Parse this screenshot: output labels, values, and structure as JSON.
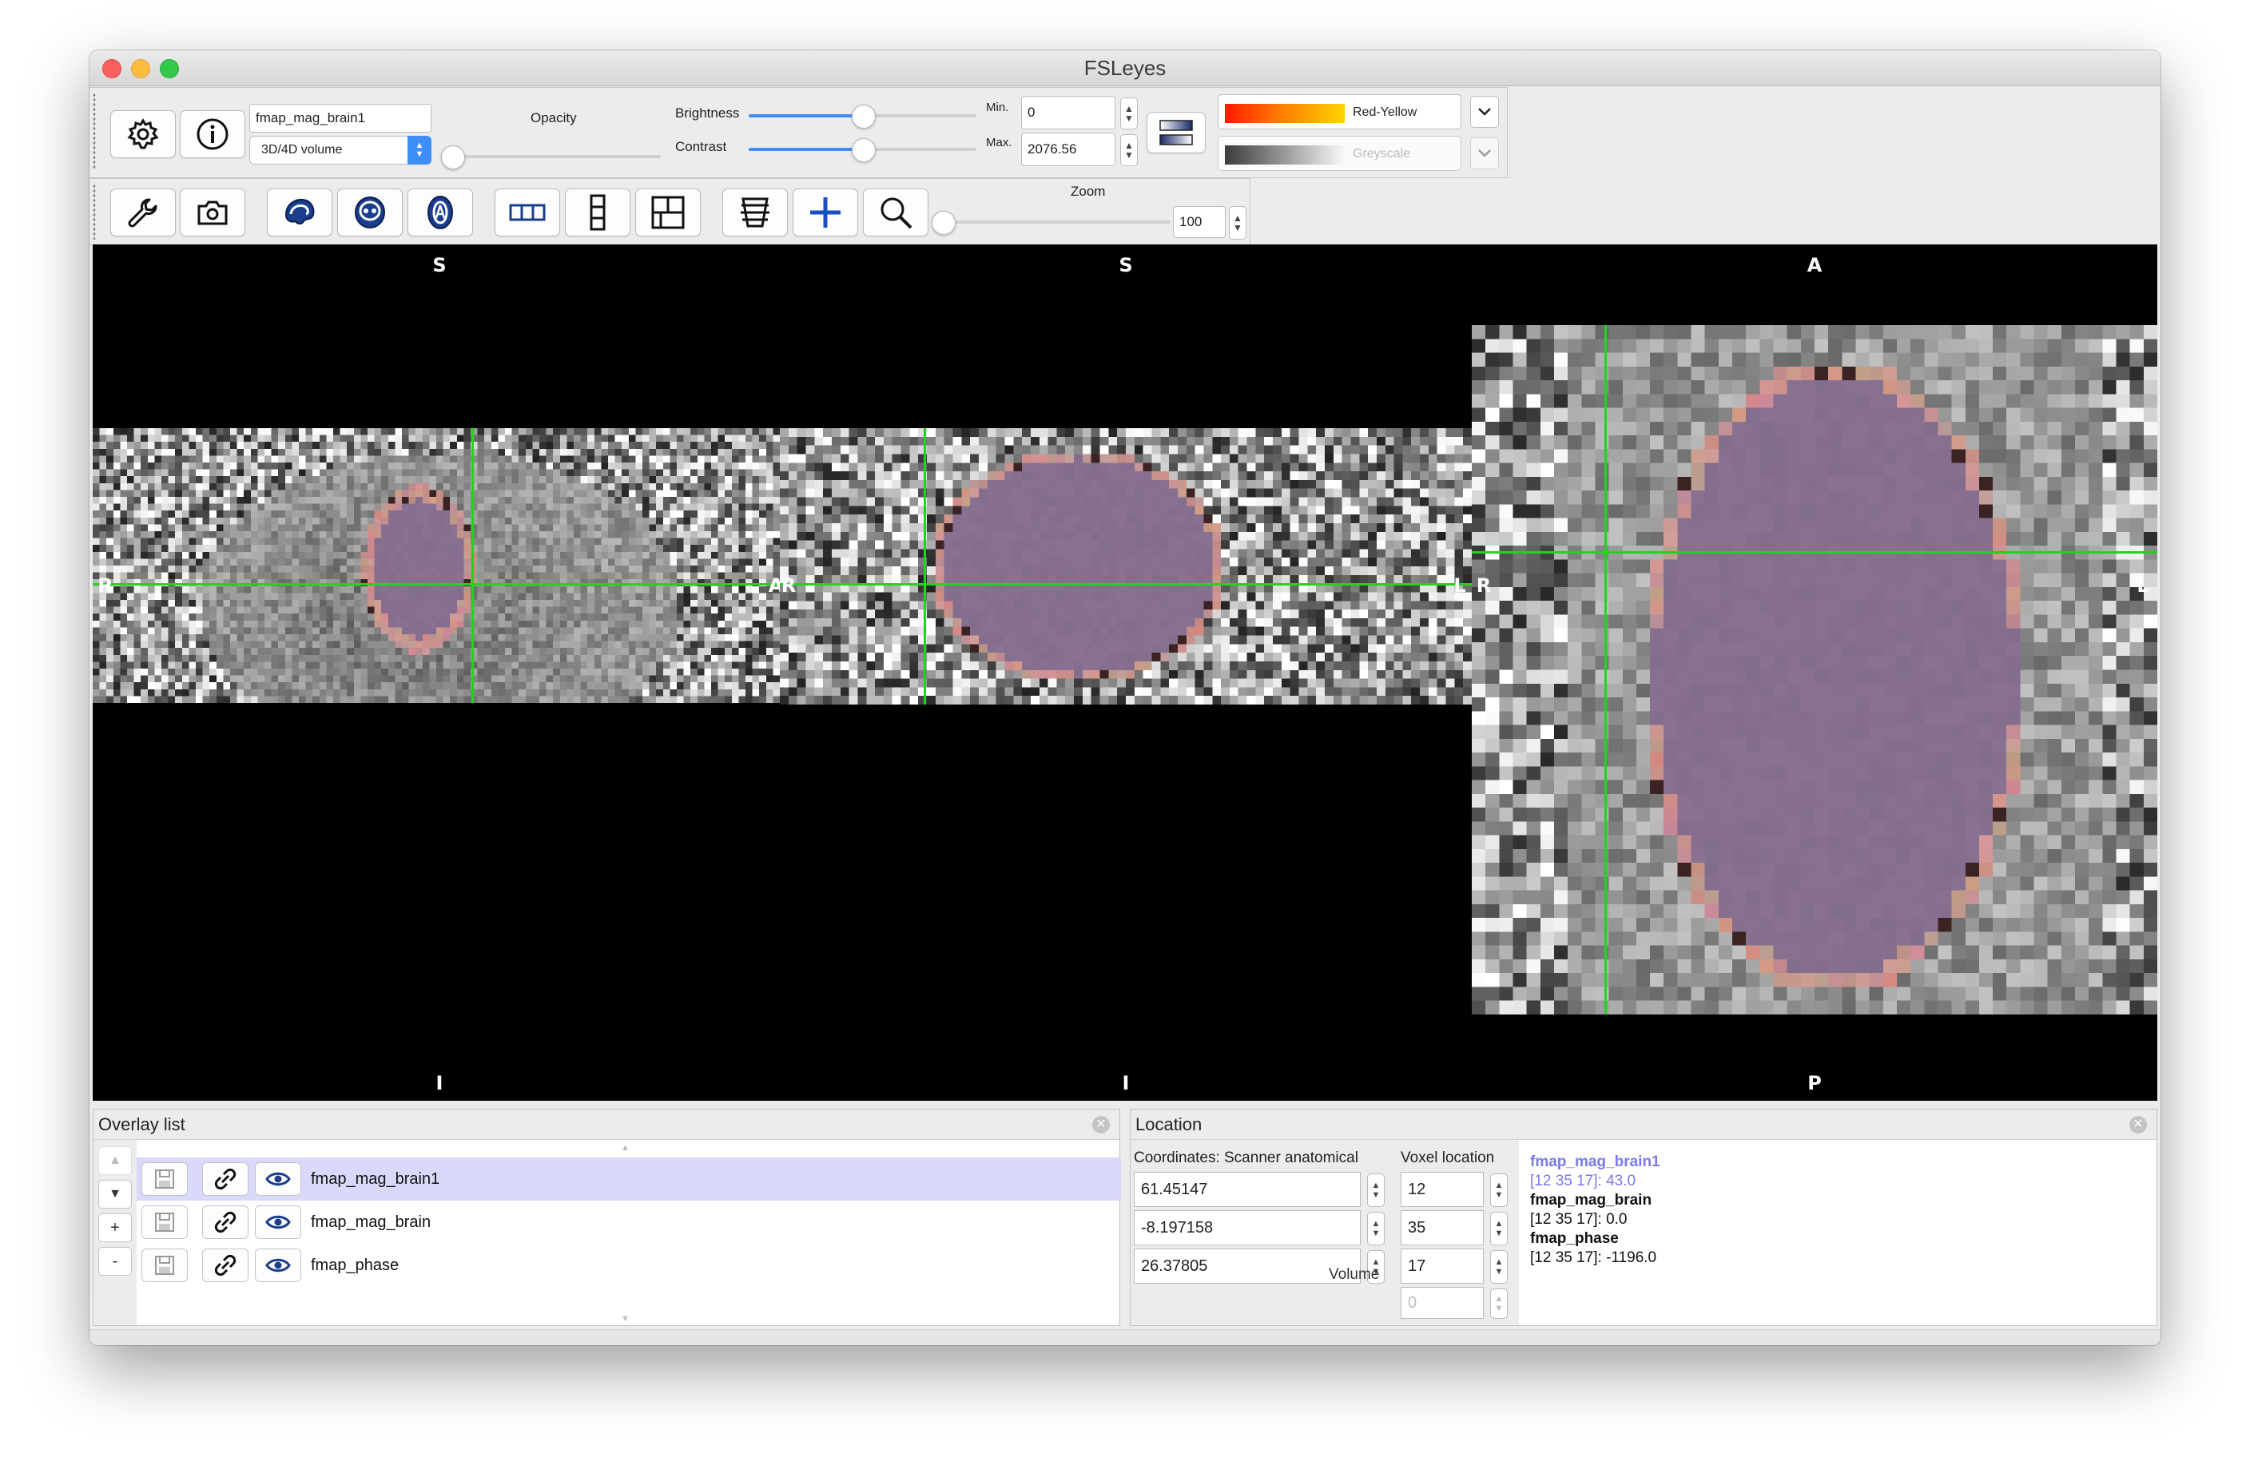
{
  "window": {
    "title": "FSLeyes"
  },
  "overlay_toolbar": {
    "overlay_name": "fmap_mag_brain1",
    "overlay_type": "3D/4D volume",
    "opacity_label": "Opacity",
    "opacity_value": 0.05,
    "brightness_label": "Brightness",
    "brightness_value": 0.5,
    "contrast_label": "Contrast",
    "contrast_value": 0.5,
    "min_label": "Min.",
    "min_value": "0",
    "max_label": "Max.",
    "max_value": "2076.56",
    "colormap_primary": "Red-Yellow",
    "colormap_secondary": "Greyscale",
    "icons": [
      "gear-icon",
      "info-icon",
      "invert-cmap-icon",
      "chevron-down-icon"
    ]
  },
  "ortho_toolbar": {
    "zoom_label": "Zoom",
    "zoom_value": "100",
    "zoom_slider": 0.0,
    "icons": [
      "wrench-icon",
      "camera-icon",
      "sagittal-icon",
      "coronal-icon",
      "axial-icon",
      "layout-horizontal-icon",
      "layout-vertical-icon",
      "layout-grid-icon",
      "movie-icon",
      "crosshair-icon",
      "zoom-icon"
    ]
  },
  "views": {
    "sagittal": {
      "top": "S",
      "bottom": "I",
      "left": "P",
      "right": "A"
    },
    "coronal": {
      "top": "S",
      "bottom": "I",
      "left": "R",
      "right": "L"
    },
    "axial": {
      "top": "A",
      "bottom": "P",
      "left": "R",
      "right": "L"
    }
  },
  "overlay_list": {
    "title": "Overlay list",
    "items": [
      {
        "name": "fmap_mag_brain1",
        "selected": true
      },
      {
        "name": "fmap_mag_brain",
        "selected": false
      },
      {
        "name": "fmap_phase",
        "selected": false
      }
    ],
    "buttons": [
      "▲",
      "▼",
      "+",
      "-"
    ]
  },
  "location": {
    "title": "Location",
    "coords_label": "Coordinates: Scanner anatomical",
    "voxel_label": "Voxel location",
    "coords": [
      "61.45147",
      "-8.197158",
      "26.37805"
    ],
    "voxels": [
      "12",
      "35",
      "17"
    ],
    "volume_label": "Volume",
    "volume_value": "0",
    "info": [
      {
        "name": "fmap_mag_brain1",
        "value": "[12 35 17]: 43.0",
        "highlight": true
      },
      {
        "name": "fmap_mag_brain",
        "value": "[12 35 17]: 0.0",
        "highlight": false
      },
      {
        "name": "fmap_phase",
        "value": "[12 35 17]: -1196.0",
        "highlight": false
      }
    ]
  },
  "colors": {
    "crosshair": "#22d322",
    "selected_row": "#d9d9fb",
    "highlight_text": "#7a7ae6",
    "accent": "#3e8ef7",
    "overlay_tint": "#8e6e96"
  }
}
